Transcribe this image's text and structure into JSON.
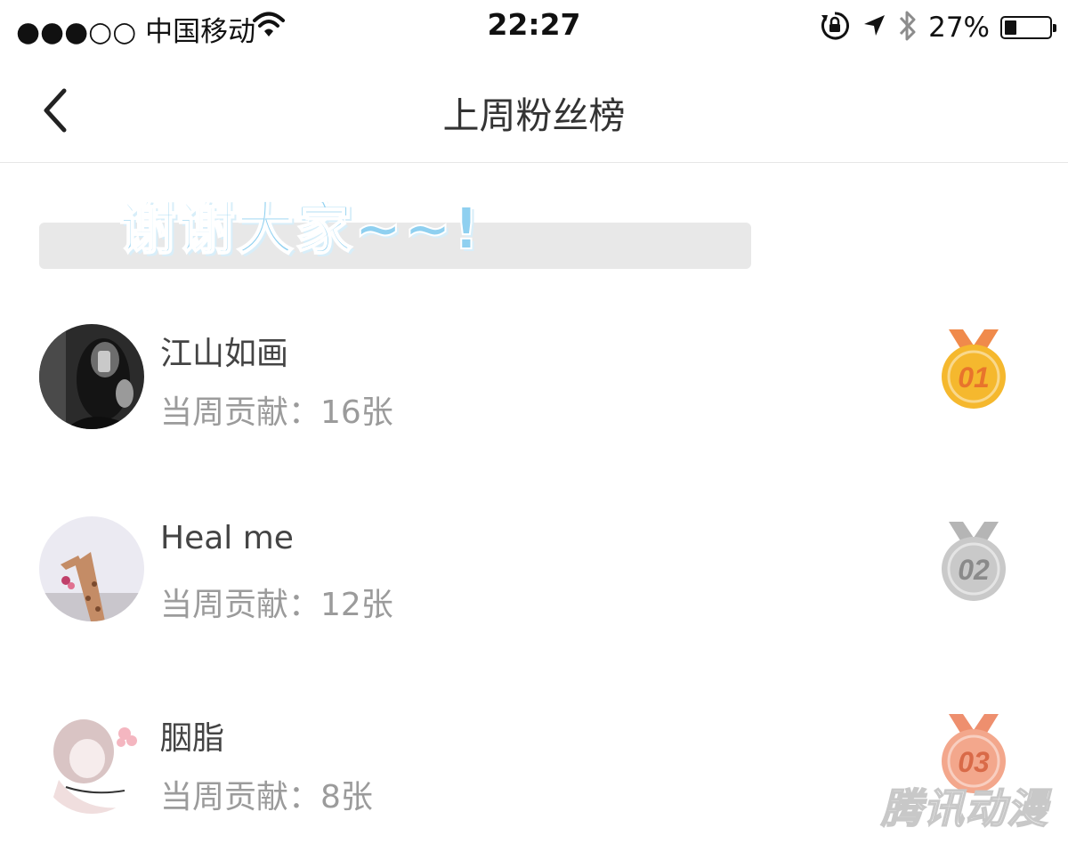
{
  "status_bar": {
    "carrier": "●●●○○ 中国移动",
    "time": "22:27",
    "battery_percent_text": "27%",
    "battery_level": 0.27,
    "icons": [
      "wifi-icon",
      "rotation-lock-icon",
      "location-arrow-icon",
      "bluetooth-icon",
      "battery-icon"
    ]
  },
  "nav": {
    "title": "上周粉丝榜",
    "back_icon": "chevron-left-icon"
  },
  "banner": {
    "text": "谢谢大家~~!"
  },
  "fans": [
    {
      "rank": "01",
      "name": "江山如画",
      "contribution": "当周贡献：16张",
      "medal_color": "#f5b82e",
      "medal_ribbon": "#f08a4b"
    },
    {
      "rank": "02",
      "name": "Heal me",
      "contribution": "当周贡献：12张",
      "medal_color": "#c9c9c9",
      "medal_ribbon": "#b5b5b5"
    },
    {
      "rank": "03",
      "name": "胭脂",
      "contribution": "当周贡献：8张",
      "medal_color": "#f3a78c",
      "medal_ribbon": "#ee8f6e"
    }
  ],
  "watermark": "腾讯动漫"
}
